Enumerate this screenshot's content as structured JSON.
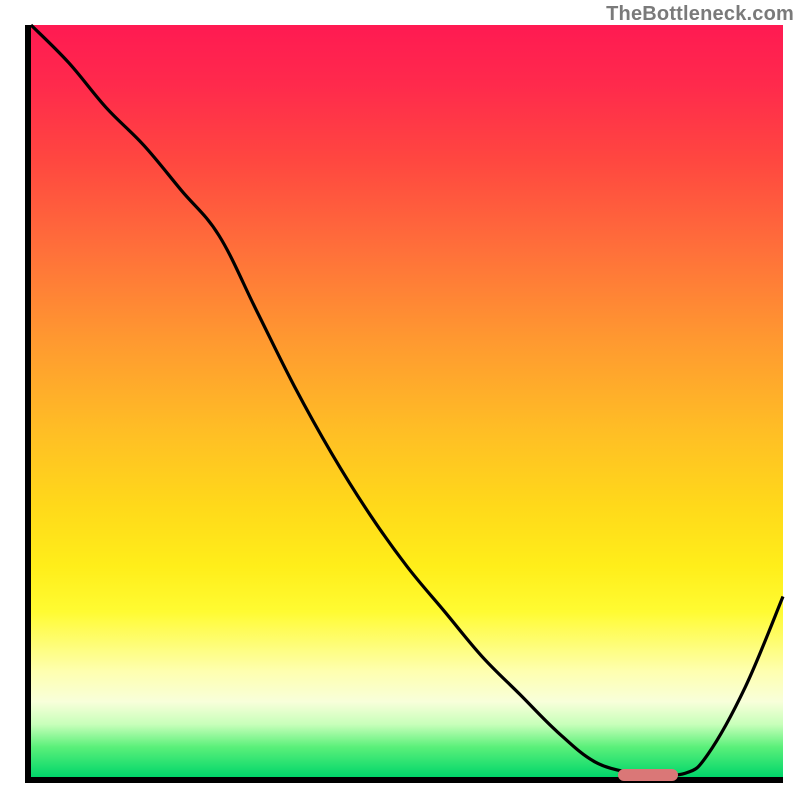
{
  "watermark": "TheBottleneck.com",
  "chart_data": {
    "type": "line",
    "title": "",
    "xlabel": "",
    "ylabel": "",
    "xlim": [
      0,
      100
    ],
    "ylim": [
      0,
      100
    ],
    "grid": false,
    "legend": false,
    "x": [
      0,
      5,
      10,
      15,
      20,
      25,
      30,
      35,
      40,
      45,
      50,
      55,
      60,
      65,
      70,
      75,
      80,
      82,
      87,
      90,
      95,
      100
    ],
    "y": [
      100,
      95,
      89,
      84,
      78,
      72,
      62,
      52,
      43,
      35,
      28,
      22,
      16,
      11,
      6,
      2,
      0.5,
      0.3,
      0.5,
      3,
      12,
      24
    ],
    "gradient_stops": [
      {
        "pos": 0,
        "color": "#ff1a52"
      },
      {
        "pos": 100,
        "color": "#00d66a"
      }
    ],
    "optimal_marker": {
      "x_start": 78,
      "x_end": 86,
      "y": 0.3
    }
  }
}
